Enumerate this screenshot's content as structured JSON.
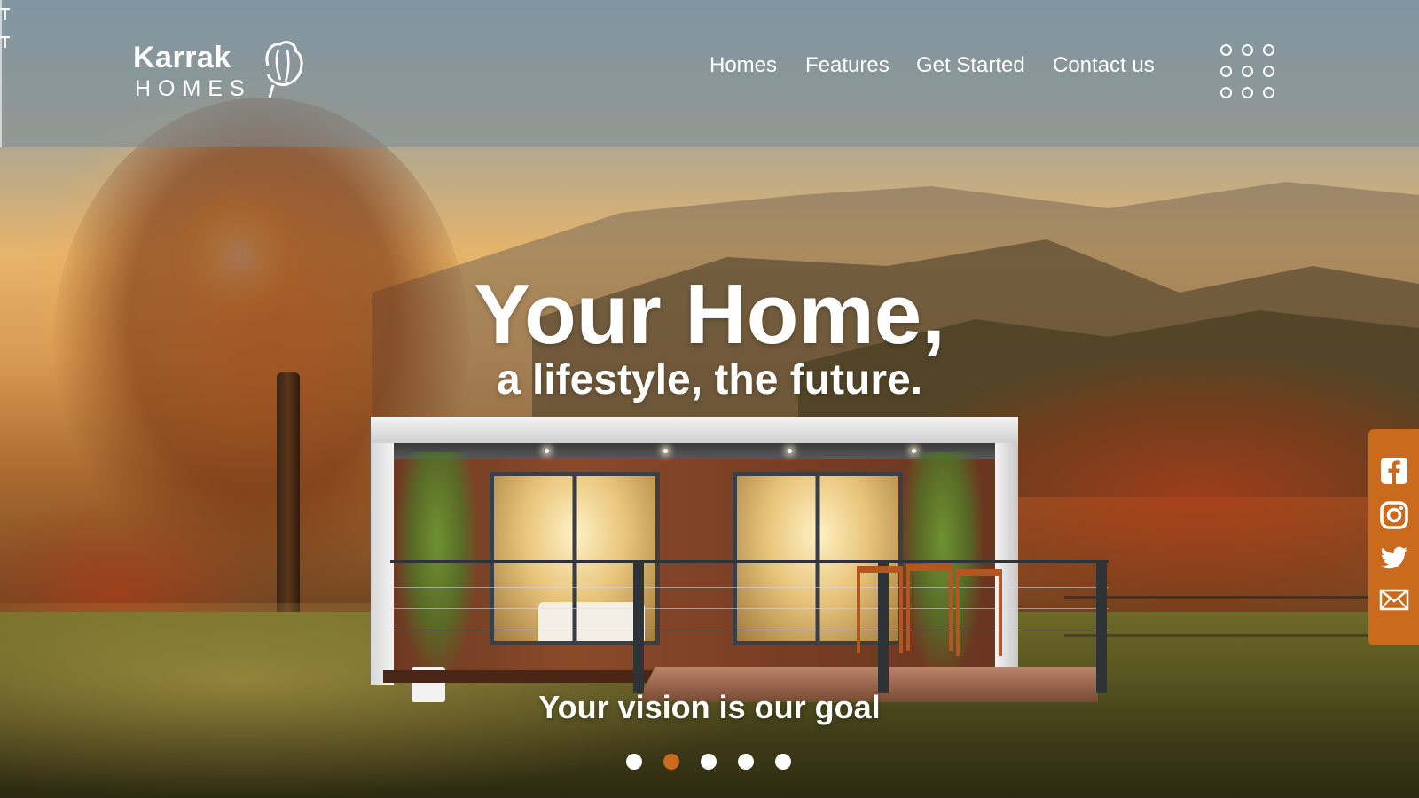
{
  "colors": {
    "accent": "#c96a1c",
    "active_dot": "#c96a1c",
    "dot": "#ffffff",
    "header_bg": "rgba(120,138,150,0.55)",
    "text": "#ffffff"
  },
  "top_strip": {
    "letters": [
      "T",
      "T"
    ]
  },
  "logo": {
    "name": "Karrak",
    "sub": "HOMES"
  },
  "nav": {
    "items": [
      {
        "label": "Homes"
      },
      {
        "label": "Features"
      },
      {
        "label": "Get Started"
      },
      {
        "label": "Contact us"
      }
    ],
    "menu_icon": "dot-grid-menu-icon"
  },
  "hero": {
    "title": "Your Home,",
    "subtitle": "a lifestyle, the future.",
    "tagline": "Your vision is our goal"
  },
  "slider": {
    "count": 5,
    "active_index": 1
  },
  "social": {
    "icons": [
      "facebook-icon",
      "instagram-icon",
      "twitter-icon",
      "email-icon"
    ]
  }
}
